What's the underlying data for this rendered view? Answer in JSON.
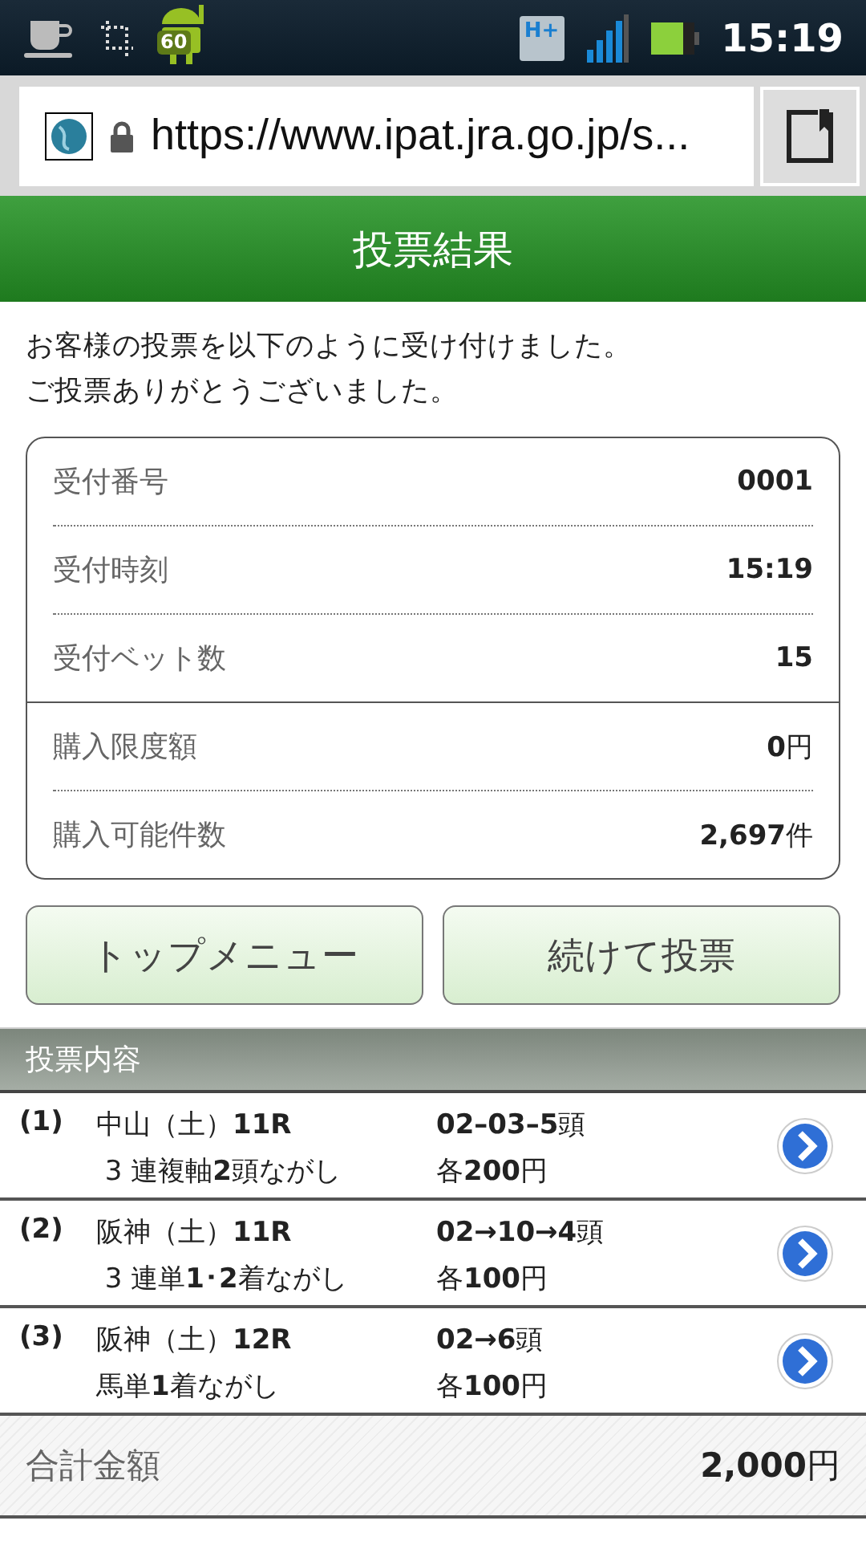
{
  "status_bar": {
    "badge": "60",
    "network": "H+",
    "time": "15:19"
  },
  "browser": {
    "url": "https://www.ipat.jra.go.jp/s..."
  },
  "header": {
    "title": "投票結果"
  },
  "message": [
    "お客様の投票を以下のように受け付けました。",
    "ご投票ありがとうございました。"
  ],
  "summary": [
    {
      "label": "受付番号",
      "value": "**0001**"
    },
    {
      "label": "受付時刻",
      "value": "**15:19**"
    },
    {
      "label": "受付ベット数",
      "value": "**15**"
    },
    {
      "label": "購入限度額",
      "value": "**0**円"
    },
    {
      "label": "購入可能件数",
      "value": "**2,697**件"
    }
  ],
  "buttons": [
    "トップメニュー",
    "続けて投票"
  ],
  "section": {
    "title": "投票内容"
  },
  "bets": [
    {
      "number": "(1)",
      "race": "中山（土）**11R**",
      "type": " 3 連複軸**2**頭ながし",
      "combination": "**02–03–5**頭",
      "amount": "各**200**円"
    },
    {
      "number": "(2)",
      "race": "阪神（土）**11R**",
      "type": " 3 連単**1･2**着ながし",
      "combination": "**02→10→4**頭",
      "amount": "各**100**円"
    },
    {
      "number": "(3)",
      "race": "阪神（土）**12R**",
      "type": "馬単**1**着ながし",
      "combination": "**02→6**頭",
      "amount": "各**100**円"
    }
  ],
  "total": {
    "label": "合計金額",
    "value": "**2,000**円"
  }
}
